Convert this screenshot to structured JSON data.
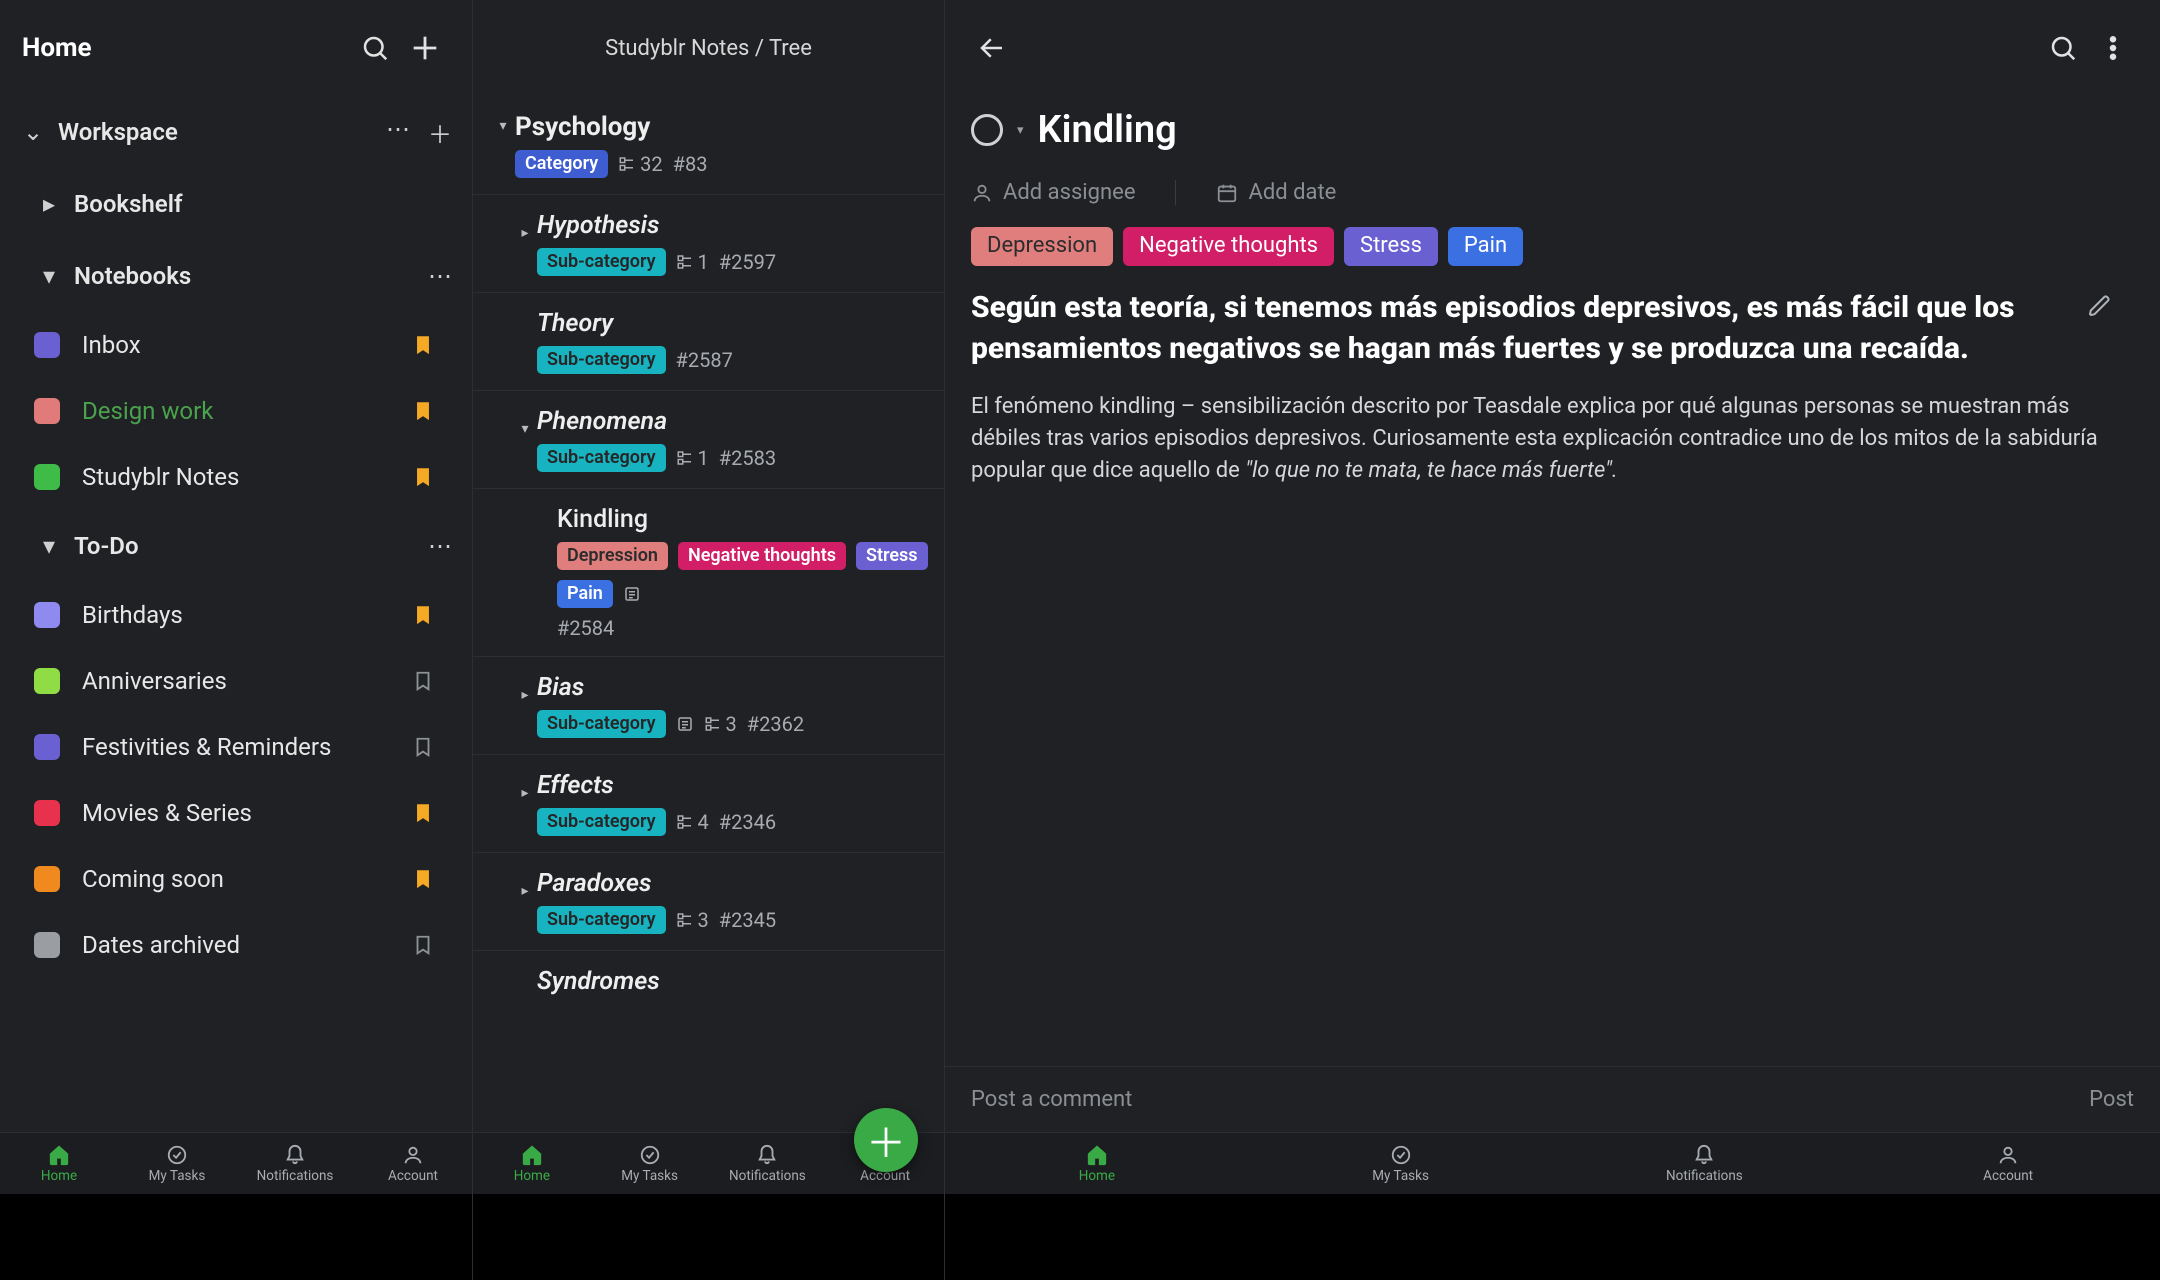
{
  "left": {
    "header_title": "Home",
    "sections": {
      "workspace": "Workspace",
      "bookshelf": "Bookshelf",
      "notebooks": "Notebooks",
      "todo": "To-Do"
    },
    "notebooks": [
      {
        "label": "Inbox",
        "color": "#6a60d2",
        "bookmarked": true,
        "accent": false
      },
      {
        "label": "Design work",
        "color": "#e07b7a",
        "bookmarked": true,
        "accent": true
      },
      {
        "label": "Studyblr Notes",
        "color": "#3fbb47",
        "bookmarked": true,
        "accent": false
      }
    ],
    "todos": [
      {
        "label": "Birthdays",
        "color": "#8f8af0",
        "bookmarked": true
      },
      {
        "label": "Anniversaries",
        "color": "#8fdc44",
        "bookmarked": false
      },
      {
        "label": "Festivities & Reminders",
        "color": "#6a60d2",
        "bookmarked": false
      },
      {
        "label": "Movies & Series",
        "color": "#e8324d",
        "bookmarked": true
      },
      {
        "label": "Coming soon",
        "color": "#f08a1f",
        "bookmarked": true
      },
      {
        "label": "Dates archived",
        "color": "#9a9da1",
        "bookmarked": false
      }
    ]
  },
  "mid": {
    "breadcrumb": "Studyblr Notes / Tree",
    "root": {
      "title": "Psychology",
      "tag": "Category",
      "children_count": "32",
      "id": "#83"
    },
    "items": [
      {
        "title": "Hypothesis",
        "tag": "Sub-category",
        "children": "1",
        "id": "#2597",
        "indent": 1,
        "caret": "right"
      },
      {
        "title": "Theory",
        "tag": "Sub-category",
        "children": "",
        "id": "#2587",
        "indent": 1,
        "caret": ""
      },
      {
        "title": "Phenomena",
        "tag": "Sub-category",
        "children": "1",
        "id": "#2583",
        "indent": 1,
        "caret": "down"
      },
      {
        "title": "Kindling",
        "tags": [
          "Depression",
          "Negative thoughts",
          "Stress",
          "Pain"
        ],
        "id": "#2584",
        "indent": 2,
        "note": true
      },
      {
        "title": "Bias",
        "tag": "Sub-category",
        "note": true,
        "children": "3",
        "id": "#2362",
        "indent": 1,
        "caret": "right"
      },
      {
        "title": "Effects",
        "tag": "Sub-category",
        "children": "4",
        "id": "#2346",
        "indent": 1,
        "caret": "right"
      },
      {
        "title": "Paradoxes",
        "tag": "Sub-category",
        "children": "3",
        "id": "#2345",
        "indent": 1,
        "caret": "right"
      },
      {
        "title": "Syndromes",
        "tag": "",
        "children": "",
        "id": "",
        "indent": 1,
        "caret": ""
      }
    ]
  },
  "right": {
    "title": "Kindling",
    "add_assignee": "Add assignee",
    "add_date": "Add date",
    "tags": [
      "Depression",
      "Negative thoughts",
      "Stress",
      "Pain"
    ],
    "heading": "Según esta teoría, si tenemos más episodios depresivos, es más fácil que los pensamientos negativos se hagan más fuertes y se produzca una recaída.",
    "para_plain": "El fenómeno kindling – sensibilización descrito por Teasdale explica por qué algunas personas se muestran más débiles tras varios episodios depresivos. Curiosamente esta explicación contradice uno de los mitos de la sabiduría popular que dice aquello de ",
    "para_quote": "\"lo que no te mata, te hace más fuerte\".",
    "comment_placeholder": "Post a comment",
    "post_button": "Post"
  },
  "nav": {
    "items": [
      "Home",
      "My Tasks",
      "Notifications",
      "Account"
    ]
  }
}
